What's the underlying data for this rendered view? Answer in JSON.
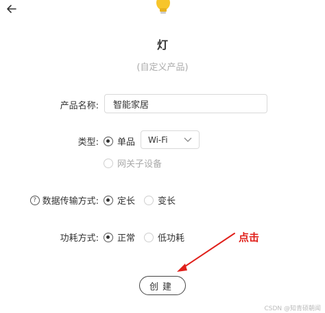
{
  "header": {
    "title": "灯",
    "subtitle": "(自定义产品)"
  },
  "form": {
    "product_name_label": "产品名称:",
    "product_name_value": "智能家居",
    "type_label": "类型:",
    "type_options": [
      "单品",
      "网关子设备"
    ],
    "type_selected": "单品",
    "connection_value": "Wi-Fi",
    "transfer_label": "数据传输方式:",
    "transfer_options": [
      "定长",
      "变长"
    ],
    "transfer_selected": "定长",
    "power_label": "功耗方式:",
    "power_options": [
      "正常",
      "低功耗"
    ],
    "power_selected": "正常"
  },
  "annotation": {
    "text": "点击",
    "color": "#e0201b"
  },
  "actions": {
    "create_label": "创建"
  },
  "watermark": "CSDN @知青硕朝闻",
  "icons": [
    "back-arrow-icon",
    "lightbulb-icon",
    "help-circle-icon",
    "chevron-down-icon"
  ]
}
